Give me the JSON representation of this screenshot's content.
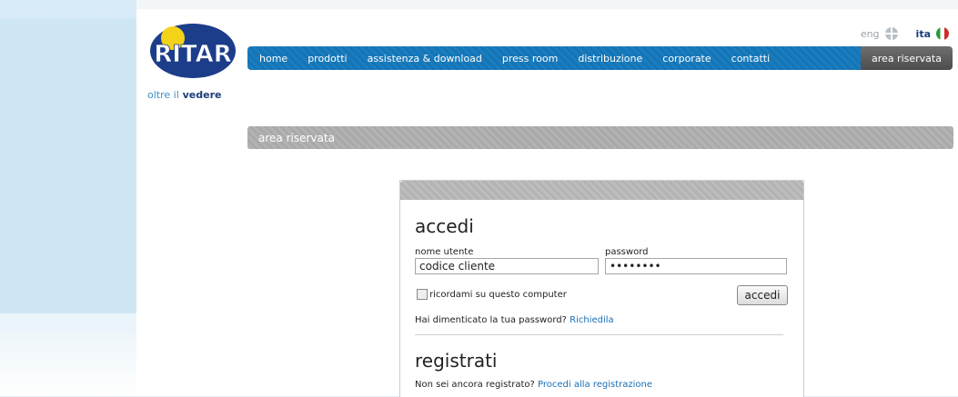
{
  "header": {
    "logo_text": "RITAR",
    "logo_tagline_light": "oltre il",
    "logo_tagline_bold": "vedere"
  },
  "language": {
    "eng": "eng",
    "ita": "ita"
  },
  "nav": {
    "items": [
      "home",
      "prodotti",
      "assistenza & download",
      "press room",
      "distribuzione",
      "corporate",
      "contatti"
    ],
    "reserved": "area riservata"
  },
  "section_title": "area riservata",
  "login": {
    "title": "accedi",
    "username_label": "nome utente",
    "username_value": "codice cliente",
    "password_label": "password",
    "password_value": "••••••••",
    "remember_label": "ricordami su questo computer",
    "submit_label": "accedi",
    "forgot_text": "Hai dimenticato la tua password?",
    "forgot_link": "Richiedila"
  },
  "register": {
    "title": "registrati",
    "prompt_text": "Non sei ancora registrato?",
    "prompt_link": "Procedi alla registrazione"
  }
}
